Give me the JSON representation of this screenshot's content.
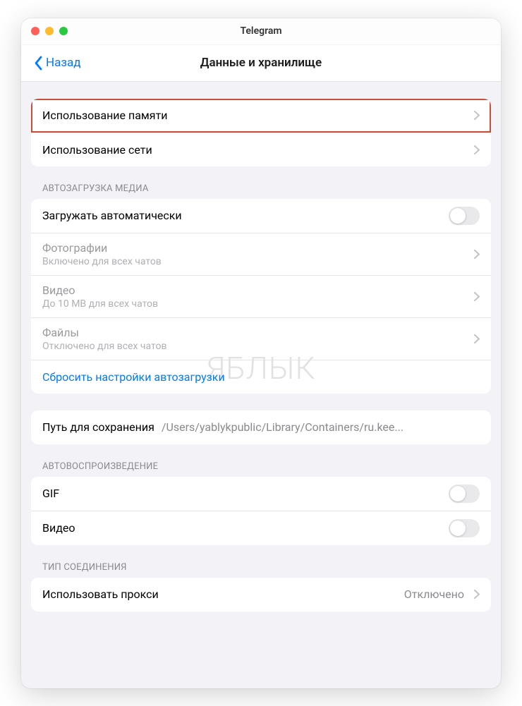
{
  "window": {
    "title": "Telegram"
  },
  "nav": {
    "back": "Назад",
    "title": "Данные и хранилище"
  },
  "usage": {
    "storage": "Использование памяти",
    "network": "Использование сети"
  },
  "automedia": {
    "header": "АВТОЗАГРУЗКА МЕДИА",
    "autoload": "Загружать автоматически",
    "photos": {
      "title": "Фотографии",
      "sub": "Включено для всех чатов"
    },
    "videos": {
      "title": "Видео",
      "sub": "До 10 MB для всех чатов"
    },
    "files": {
      "title": "Файлы",
      "sub": "Отключено для всех чатов"
    },
    "reset": "Сбросить настройки автозагрузки"
  },
  "savepath": {
    "label": "Путь для сохранения",
    "value": "/Users/yablykpublic/Library/Containers/ru.kee..."
  },
  "autoplay": {
    "header": "АВТОВОСПРОИЗВЕДЕНИЕ",
    "gif": "GIF",
    "video": "Видео"
  },
  "connection": {
    "header": "ТИП СОЕДИНЕНИЯ",
    "proxy": "Использовать прокси",
    "proxy_value": "Отключено"
  },
  "watermark": "ЯБЛЫК"
}
